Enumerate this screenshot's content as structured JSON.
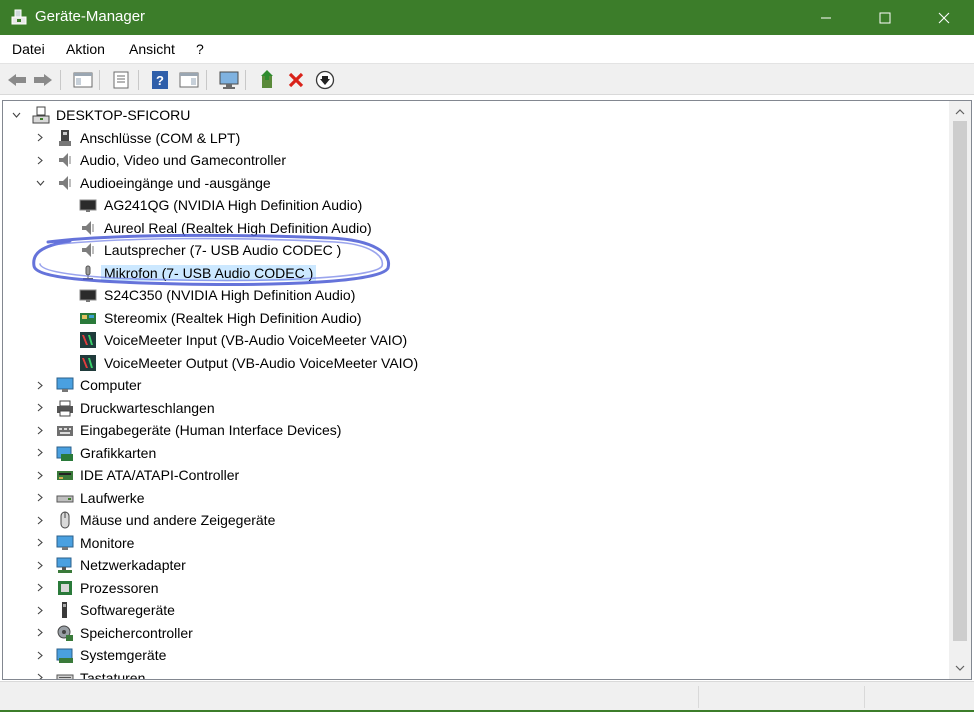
{
  "window": {
    "title": "Geräte-Manager",
    "accent": "#3c7d2a"
  },
  "menu": {
    "items": [
      "Datei",
      "Aktion",
      "Ansicht",
      "?"
    ]
  },
  "toolbar": {
    "buttons": [
      "back-icon",
      "forward-icon",
      "console-tree-icon",
      "properties-icon",
      "help-icon",
      "action-pane-icon",
      "monitor-icon",
      "update-driver-icon",
      "uninstall-icon",
      "disable-icon"
    ]
  },
  "tree": {
    "root": "DESKTOP-SFICORU",
    "categories": [
      {
        "label": "Anschlüsse (COM & LPT)",
        "expanded": false
      },
      {
        "label": "Audio, Video und Gamecontroller",
        "expanded": false
      },
      {
        "label": "Audioeingänge und -ausgänge",
        "expanded": true
      },
      {
        "label": "Computer",
        "expanded": false
      },
      {
        "label": "Druckwarteschlangen",
        "expanded": false
      },
      {
        "label": "Eingabegeräte (Human Interface Devices)",
        "expanded": false
      },
      {
        "label": "Grafikkarten",
        "expanded": false
      },
      {
        "label": "IDE ATA/ATAPI-Controller",
        "expanded": false
      },
      {
        "label": "Laufwerke",
        "expanded": false
      },
      {
        "label": "Mäuse und andere Zeigegeräte",
        "expanded": false
      },
      {
        "label": "Monitore",
        "expanded": false
      },
      {
        "label": "Netzwerkadapter",
        "expanded": false
      },
      {
        "label": "Prozessoren",
        "expanded": false
      },
      {
        "label": "Softwaregeräte",
        "expanded": false
      },
      {
        "label": "Speichercontroller",
        "expanded": false
      },
      {
        "label": "Systemgeräte",
        "expanded": false
      },
      {
        "label": "Tastaturen",
        "expanded": false
      }
    ],
    "audio_devices": [
      {
        "label": "AG241QG (NVIDIA High Definition Audio)"
      },
      {
        "label": "Aureol Real (Realtek High Definition Audio)"
      },
      {
        "label": "Lautsprecher (7- USB Audio CODEC )"
      },
      {
        "label": "Mikrofon (7- USB Audio CODEC )",
        "selected": true
      },
      {
        "label": "S24C350 (NVIDIA High Definition Audio)"
      },
      {
        "label": "Stereomix (Realtek High Definition Audio)"
      },
      {
        "label": "VoiceMeeter Input (VB-Audio VoiceMeeter VAIO)"
      },
      {
        "label": "VoiceMeeter Output (VB-Audio VoiceMeeter VAIO)"
      }
    ]
  }
}
